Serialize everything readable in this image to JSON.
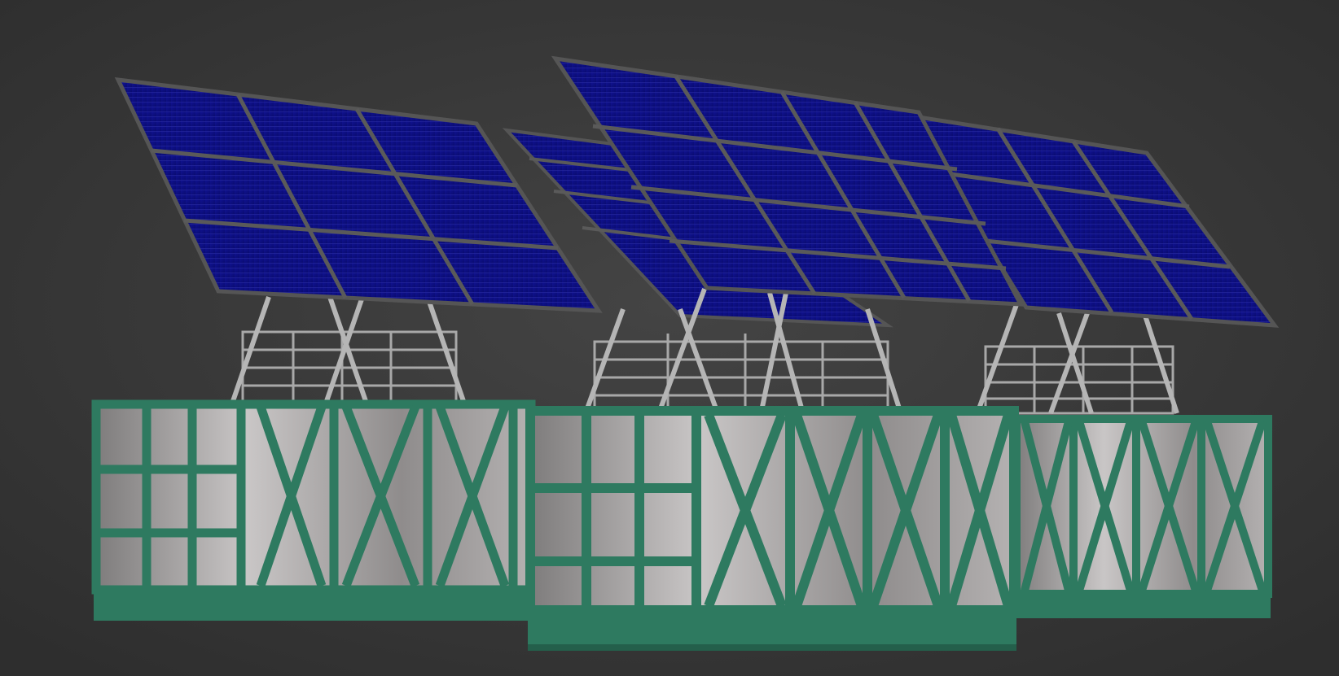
{
  "scene": {
    "kind": "3d-render",
    "subject": "three-solar-tracker-skids",
    "units": [
      {
        "id": "left",
        "panel_grid": "3x3"
      },
      {
        "id": "middle",
        "panel_grid": "4x4"
      },
      {
        "id": "right",
        "panel_grid": "3x3"
      }
    ]
  },
  "colors": {
    "background": "#3a3a3a",
    "panel_cell": "#0d0f86",
    "panel_frame": "#5a5a5a",
    "container_frame": "#2e7a60",
    "container_frame_dark": "#245f4b",
    "container_wall": "#9b9898",
    "railing": "#a8a8a8"
  }
}
